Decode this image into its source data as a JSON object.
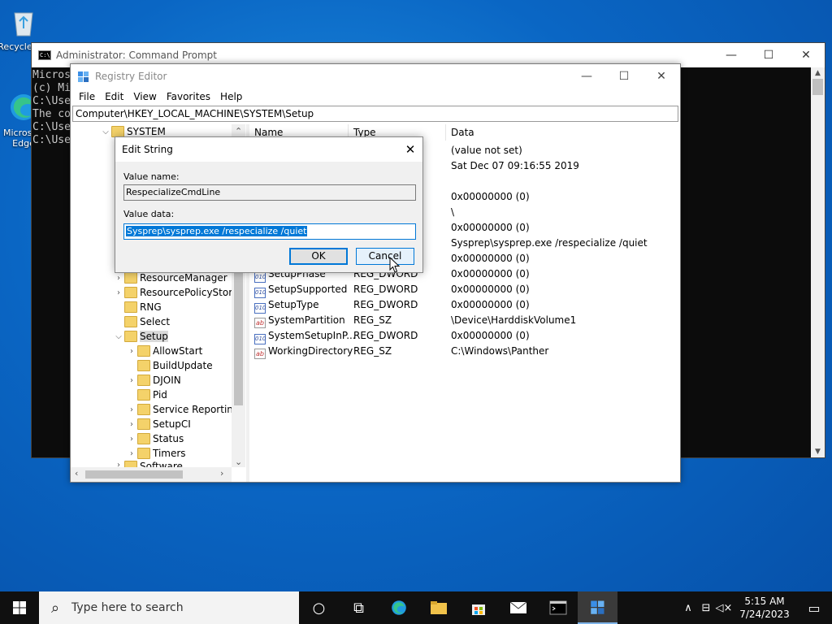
{
  "desktop": {
    "icons": [
      {
        "label": "Recycle Bin",
        "icon": "recycle-bin-icon"
      },
      {
        "label": "Microsoft Edge",
        "icon": "edge-icon"
      }
    ]
  },
  "cmd": {
    "title": "Administrator: Command Prompt",
    "icon_text": "C:\\.",
    "lines": [
      "Micros",
      "(c) Mi",
      "",
      "C:\\Use",
      "The co",
      "",
      "",
      "C:\\Use",
      "",
      "C:\\Use"
    ]
  },
  "regedit": {
    "title": "Registry Editor",
    "menu": [
      "File",
      "Edit",
      "View",
      "Favorites",
      "Help"
    ],
    "address": "Computer\\HKEY_LOCAL_MACHINE\\SYSTEM\\Setup",
    "tree": [
      {
        "label": "SYSTEM",
        "expander": "⌵"
      },
      {
        "label": "ResourceManager",
        "expander": "›"
      },
      {
        "label": "ResourcePolicyStore",
        "expander": "›"
      },
      {
        "label": "RNG",
        "expander": ""
      },
      {
        "label": "Select",
        "expander": ""
      },
      {
        "label": "Setup",
        "expander": "⌵"
      },
      {
        "label": "AllowStart",
        "expander": "›"
      },
      {
        "label": "BuildUpdate",
        "expander": ""
      },
      {
        "label": "DJOIN",
        "expander": "›"
      },
      {
        "label": "Pid",
        "expander": ""
      },
      {
        "label": "Service Reporting",
        "expander": "›"
      },
      {
        "label": "SetupCI",
        "expander": "›"
      },
      {
        "label": "Status",
        "expander": "›"
      },
      {
        "label": "Timers",
        "expander": "›"
      },
      {
        "label": "Software",
        "expander": "›"
      }
    ],
    "columns": {
      "name": "Name",
      "type": "Type",
      "data": "Data"
    },
    "values": [
      {
        "name": "",
        "type": "",
        "data": "(value not set)",
        "kind": ""
      },
      {
        "name": "",
        "type": "",
        "data": "Sat Dec 07 09:16:55 2019",
        "kind": ""
      },
      {
        "name": "",
        "type": "",
        "data": "",
        "kind": ""
      },
      {
        "name": "",
        "type": "",
        "data": "0x00000000 (0)",
        "kind": ""
      },
      {
        "name": "",
        "type": "",
        "data": "\\",
        "kind": ""
      },
      {
        "name": "",
        "type": "",
        "data": "0x00000000 (0)",
        "kind": ""
      },
      {
        "name": "",
        "type": "",
        "data": "Sysprep\\sysprep.exe /respecialize /quiet",
        "kind": ""
      },
      {
        "name": "",
        "type": "",
        "data": "0x00000000 (0)",
        "kind": ""
      },
      {
        "name": "SetupPhase",
        "type": "REG_DWORD",
        "data": "0x00000000 (0)",
        "kind": "dword"
      },
      {
        "name": "SetupSupported",
        "type": "REG_DWORD",
        "data": "0x00000000 (0)",
        "kind": "dword"
      },
      {
        "name": "SetupType",
        "type": "REG_DWORD",
        "data": "0x00000000 (0)",
        "kind": "dword"
      },
      {
        "name": "SystemPartition",
        "type": "REG_SZ",
        "data": "\\Device\\HarddiskVolume1",
        "kind": "sz"
      },
      {
        "name": "SystemSetupInP...",
        "type": "REG_DWORD",
        "data": "0x00000000 (0)",
        "kind": "dword"
      },
      {
        "name": "WorkingDirectory",
        "type": "REG_SZ",
        "data": "C:\\Windows\\Panther",
        "kind": "sz"
      }
    ]
  },
  "dialog": {
    "title": "Edit String",
    "value_name_label": "Value name:",
    "value_name": "RespecializeCmdLine",
    "value_data_label": "Value data:",
    "value_data": "Sysprep\\sysprep.exe /respecialize /quiet",
    "ok_label": "OK",
    "cancel_label": "Cancel"
  },
  "taskbar": {
    "search_placeholder": "Type here to search",
    "time": "5:15 AM",
    "date": "7/24/2023",
    "accent": "#0078d7"
  }
}
